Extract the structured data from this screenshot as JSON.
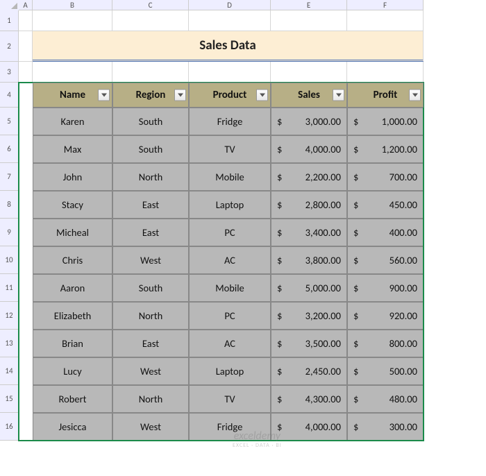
{
  "columns": [
    "A",
    "B",
    "C",
    "D",
    "E",
    "F"
  ],
  "rows": [
    "1",
    "2",
    "3",
    "4",
    "5",
    "6",
    "7",
    "8",
    "9",
    "10",
    "11",
    "12",
    "13",
    "14",
    "15",
    "16"
  ],
  "title": "Sales Data",
  "headers": [
    "Name",
    "Region",
    "Product",
    "Sales",
    "Profit"
  ],
  "data": [
    {
      "name": "Karen",
      "region": "South",
      "product": "Fridge",
      "sales": "3,000.00",
      "profit": "1,000.00"
    },
    {
      "name": "Max",
      "region": "South",
      "product": "TV",
      "sales": "4,000.00",
      "profit": "1,200.00"
    },
    {
      "name": "John",
      "region": "North",
      "product": "Mobile",
      "sales": "2,200.00",
      "profit": "700.00"
    },
    {
      "name": "Stacy",
      "region": "East",
      "product": "Laptop",
      "sales": "2,800.00",
      "profit": "450.00"
    },
    {
      "name": "Micheal",
      "region": "East",
      "product": "PC",
      "sales": "3,400.00",
      "profit": "400.00"
    },
    {
      "name": "Chris",
      "region": "West",
      "product": "AC",
      "sales": "3,800.00",
      "profit": "560.00"
    },
    {
      "name": "Aaron",
      "region": "South",
      "product": "Mobile",
      "sales": "5,000.00",
      "profit": "900.00"
    },
    {
      "name": "Elizabeth",
      "region": "North",
      "product": "PC",
      "sales": "3,200.00",
      "profit": "920.00"
    },
    {
      "name": "Brian",
      "region": "East",
      "product": "AC",
      "sales": "3,500.00",
      "profit": "800.00"
    },
    {
      "name": "Lucy",
      "region": "West",
      "product": "Laptop",
      "sales": "2,450.00",
      "profit": "500.00"
    },
    {
      "name": "Robert",
      "region": "North",
      "product": "TV",
      "sales": "4,300.00",
      "profit": "480.00"
    },
    {
      "name": "Jesicca",
      "region": "West",
      "product": "Fridge",
      "sales": "4,000.00",
      "profit": "300.00"
    }
  ],
  "currency": "$",
  "watermark": {
    "line1": "exceldemy",
    "line2": "EXCEL · DATA · BI"
  }
}
